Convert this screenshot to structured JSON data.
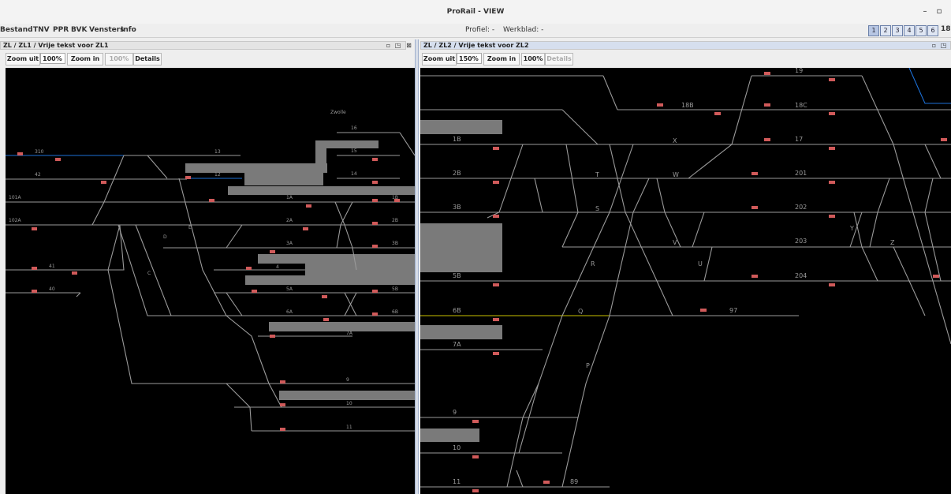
{
  "window": {
    "title": "ProRail - VIEW",
    "minimize": "–",
    "maximize": "▫"
  },
  "menu": [
    {
      "label": "Bestand"
    },
    {
      "label": "TNV"
    },
    {
      "label": "PPR"
    },
    {
      "label": "BVK"
    },
    {
      "label": "Vensters"
    },
    {
      "label": "Info"
    }
  ],
  "status": {
    "profiel": "Profiel: -",
    "werkblad": "Werkblad: -"
  },
  "workspaces": [
    {
      "label": "1",
      "active": true
    },
    {
      "label": "2"
    },
    {
      "label": "3"
    },
    {
      "label": "4"
    },
    {
      "label": "5"
    },
    {
      "label": "6"
    },
    {
      "label": "18"
    }
  ],
  "colors": {
    "track": "#9a9a9a",
    "signal": "#d05a5a",
    "occupied": "#7a7a7a",
    "route_blue": "#1c6fd6",
    "route_yellow": "#c9c000"
  },
  "left_pane": {
    "title": "ZL / ZL1 / Vrije tekst voor ZL1",
    "zoom_out": "Zoom uit",
    "zoom_value": "100%",
    "zoom_in": "Zoom in",
    "zoom_reset": "100%",
    "details": "Details",
    "place_label": "Zwolle",
    "track_labels": [
      "16",
      "15",
      "14",
      "13",
      "12",
      "310",
      "42",
      "101A",
      "102A",
      "1A",
      "1B",
      "2A",
      "2B",
      "3A",
      "3B",
      "4",
      "41",
      "40",
      "5A",
      "5B",
      "6A",
      "6B",
      "7A",
      "9",
      "10",
      "11",
      "C",
      "D",
      "E"
    ]
  },
  "right_pane": {
    "title": "ZL / ZL2 / Vrije tekst voor ZL2",
    "zoom_out": "Zoom uit",
    "zoom_value": "150%",
    "zoom_in": "Zoom in",
    "zoom_reset": "100%",
    "details": "Details",
    "track_labels": [
      "19",
      "18B",
      "18C",
      "1B",
      "17",
      "2B",
      "201",
      "3B",
      "202",
      "203",
      "5B",
      "204",
      "6B",
      "97",
      "7A",
      "9",
      "10",
      "11",
      "89",
      "X",
      "T",
      "W",
      "S",
      "V",
      "U",
      "R",
      "Q",
      "P",
      "Y",
      "Z"
    ]
  }
}
